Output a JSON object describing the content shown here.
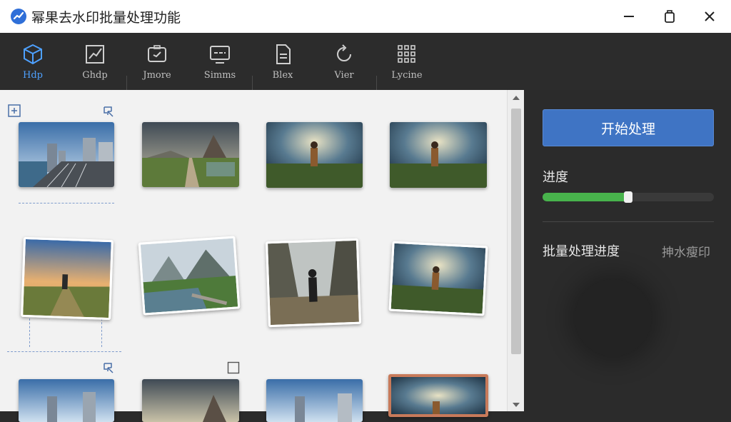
{
  "window": {
    "title": "幂果去水印批量处理功能",
    "logo_icon": "app-logo-icon",
    "controls": [
      "minimize-icon",
      "restore-icon",
      "close-icon"
    ]
  },
  "toolbar": {
    "items": [
      {
        "label": "Hdp",
        "icon": "cube-icon",
        "active": true
      },
      {
        "label": "Ghdp",
        "icon": "chart-edit-icon",
        "active": false
      },
      {
        "label": "Jmore",
        "icon": "image-tag-icon",
        "active": false
      },
      {
        "label": "Simms",
        "icon": "monitor-icon",
        "active": false
      },
      {
        "label": "Blex",
        "icon": "document-icon",
        "active": false
      },
      {
        "label": "Vier",
        "icon": "refresh-icon",
        "active": false
      },
      {
        "label": "Lycine",
        "icon": "grid-dots-icon",
        "active": false
      }
    ],
    "close_icon": "panel-close-icon"
  },
  "side_panel": {
    "start_button": "开始处理",
    "progress_label": "进度",
    "progress_value": 0.5,
    "batch_label": "批量处理进度",
    "batch_value": "抻水瘦印"
  },
  "colors": {
    "accent": "#3f74c4",
    "active_tool": "#4ea1ff",
    "progress": "#48b34c",
    "panel_bg": "#2b2b2b",
    "grid_bg": "#f2f2f2"
  },
  "thumbnails": [
    {
      "scene": "city-bridge"
    },
    {
      "scene": "mountain-road"
    },
    {
      "scene": "person-field-sunset"
    },
    {
      "scene": "person-field-sunset"
    },
    {
      "scene": "person-hill-sunrise"
    },
    {
      "scene": "mountain-lake"
    },
    {
      "scene": "canyon-walker"
    },
    {
      "scene": "person-field-sunset"
    },
    {
      "scene": "city-bridge"
    },
    {
      "scene": "mountain-road"
    },
    {
      "scene": "city-bridge"
    },
    {
      "scene": "person-field-sunset"
    }
  ]
}
